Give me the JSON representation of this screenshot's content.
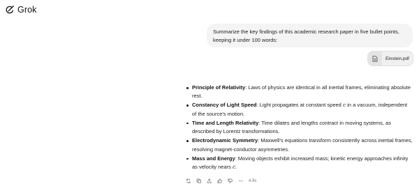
{
  "app": {
    "name": "Grok"
  },
  "user_message": {
    "text": "Summarize the key findings of this academic research paper in five bullet points, keeping it under 100 words:",
    "attachment": {
      "name": "Einstein.pdf",
      "icon": "file-document-icon"
    }
  },
  "response": {
    "bullets": [
      {
        "term": "Principle of Relativity",
        "pre": ": Laws of physics are identical in all inertial frames, eliminating absolute rest.",
        "c": "",
        "post": ""
      },
      {
        "term": "Constancy of Light Speed",
        "pre": ": Light propagates at constant speed ",
        "c": "c",
        "post": " in a vacuum, independent of the source's motion."
      },
      {
        "term": "Time and Length Relativity",
        "pre": ": Time dilates and lengths contract in moving systems, as described by Lorentz transformations.",
        "c": "",
        "post": ""
      },
      {
        "term": "Electrodynamic Symmetry",
        "pre": ": Maxwell's equations transform consistently across inertial frames, resolving magnet-conductor asymmetries.",
        "c": "",
        "post": ""
      },
      {
        "term": "Mass and Energy",
        "pre": ": Moving objects exhibit increased mass; kinetic energy approaches infinity as velocity nears ",
        "c": "c",
        "post": "."
      }
    ],
    "actions": [
      "regenerate-icon",
      "copy-icon",
      "share-icon",
      "thumbs-up-icon",
      "thumbs-down-icon",
      "more-icon"
    ],
    "elapsed": "4.9s"
  }
}
